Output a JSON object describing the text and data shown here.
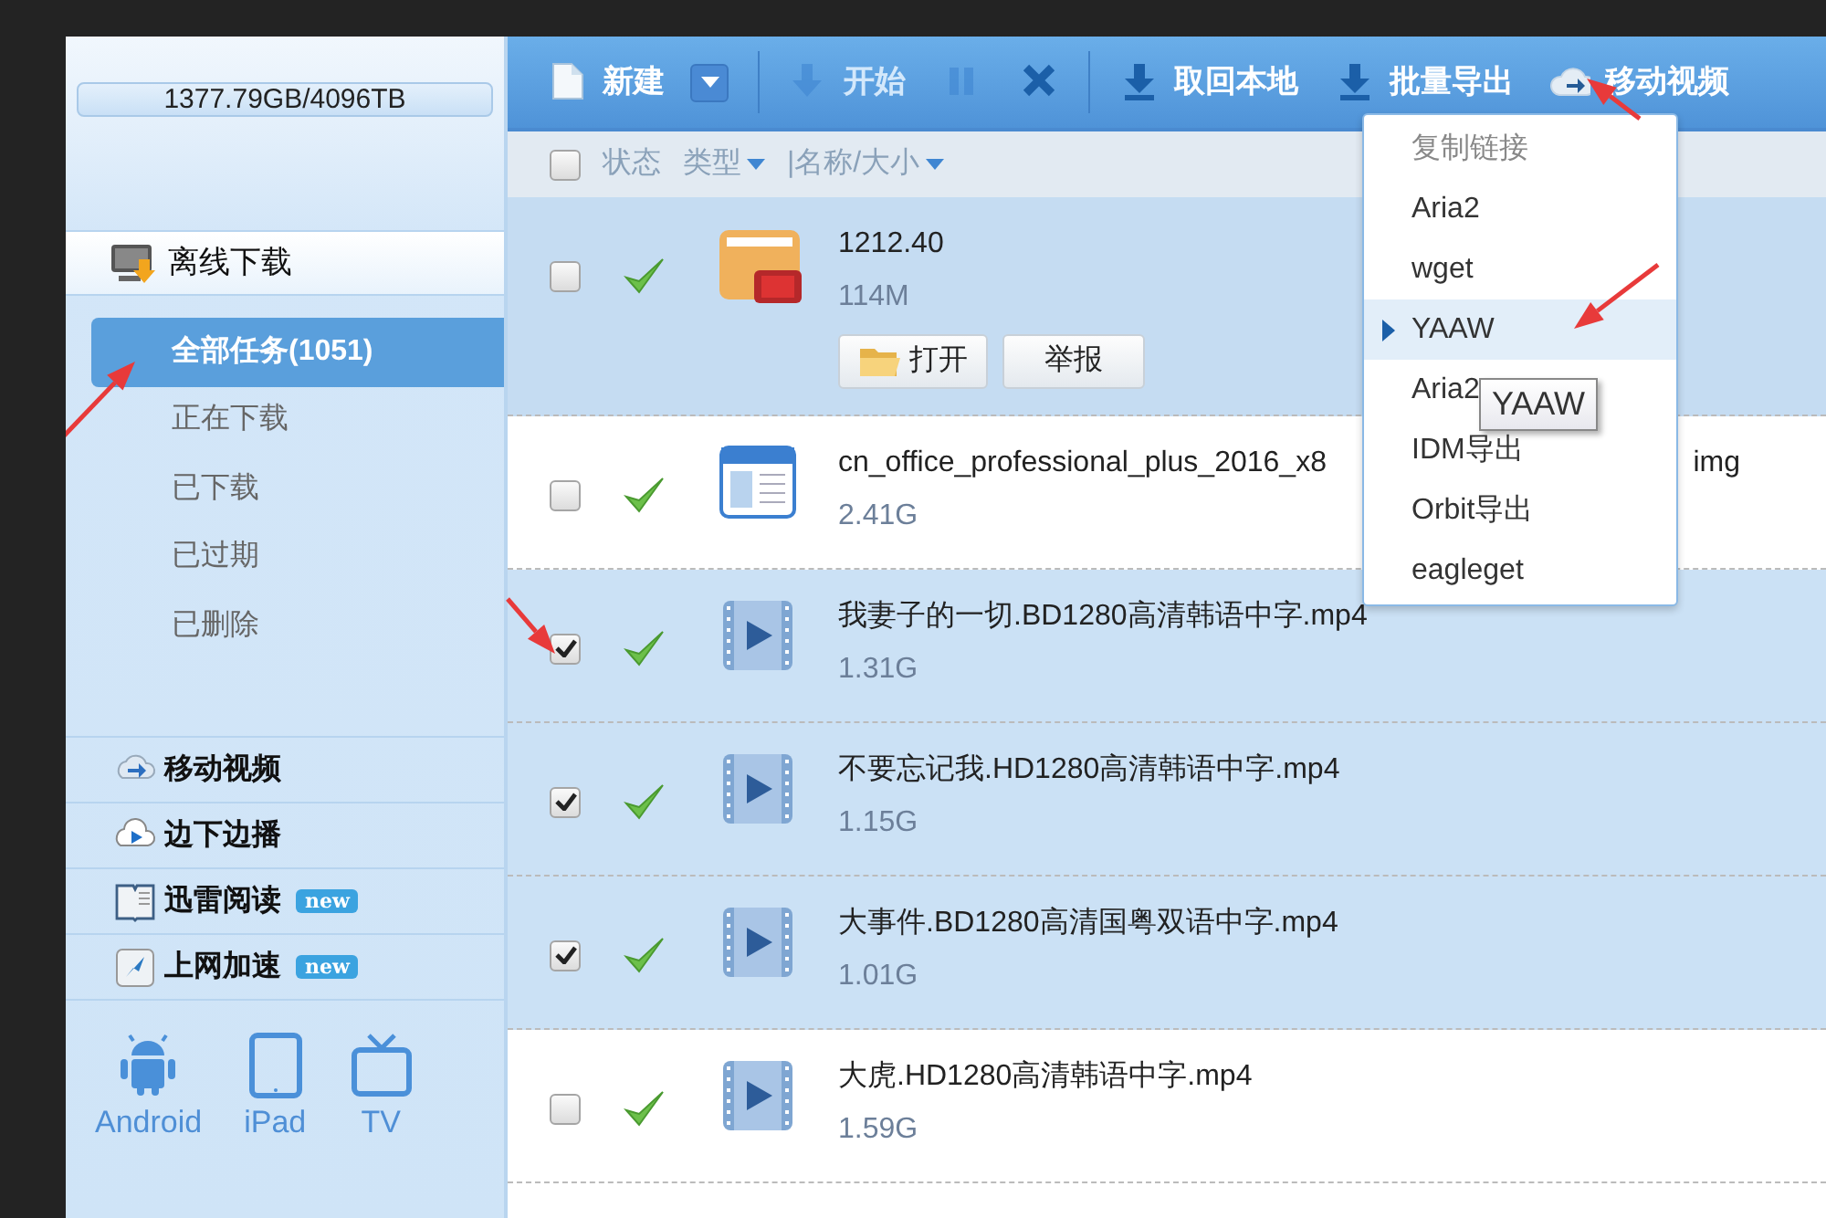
{
  "sidebar": {
    "storage": "1377.79GB/4096TB",
    "section": {
      "label": "离线下载",
      "items": [
        {
          "label": "全部任务(1051)",
          "selected": true
        },
        {
          "label": "正在下载",
          "selected": false
        },
        {
          "label": "已下载",
          "selected": false
        },
        {
          "label": "已过期",
          "selected": false
        },
        {
          "label": "已删除",
          "selected": false
        }
      ]
    },
    "links": [
      {
        "label": "移动视频",
        "kind": "cloud-arrow"
      },
      {
        "label": "边下边播",
        "kind": "cloud-play"
      },
      {
        "label": "迅雷阅读",
        "kind": "book",
        "badge": "new"
      },
      {
        "label": "上网加速",
        "kind": "bird",
        "badge": "new"
      }
    ],
    "devices": [
      {
        "label": "Android",
        "kind": "android"
      },
      {
        "label": "iPad",
        "kind": "tablet"
      },
      {
        "label": "TV",
        "kind": "tv"
      }
    ]
  },
  "toolbar": [
    {
      "label": "新建",
      "kind": "new",
      "disabled": false
    },
    {
      "label": "开始",
      "kind": "start",
      "disabled": true
    },
    {
      "kind": "pause",
      "disabled": true
    },
    {
      "kind": "delete",
      "disabled": false
    },
    {
      "label": "取回本地",
      "kind": "download",
      "disabled": false
    },
    {
      "label": "批量导出",
      "kind": "download",
      "disabled": false
    },
    {
      "label": "移动视频",
      "kind": "cloud",
      "disabled": false
    }
  ],
  "table": {
    "select_all_checked": false,
    "columns": [
      "状态",
      "类型",
      "|名称/大小"
    ],
    "rows": [
      {
        "checked": false,
        "hovered": true,
        "kind": "bt",
        "name": "1212.40",
        "size": "114M",
        "actions": [
          "打开",
          "举报"
        ]
      },
      {
        "checked": false,
        "hovered": false,
        "kind": "web",
        "name": "cn_office_professional_plus_2016_x8",
        "name_tail": "img",
        "size": "2.41G"
      },
      {
        "checked": true,
        "hovered": false,
        "kind": "video",
        "name": "我妻子的一切.BD1280高清韩语中字.mp4",
        "size": "1.31G"
      },
      {
        "checked": true,
        "hovered": false,
        "kind": "video",
        "name": "不要忘记我.HD1280高清韩语中字.mp4",
        "size": "1.15G"
      },
      {
        "checked": true,
        "hovered": false,
        "kind": "video",
        "name": "大事件.BD1280高清国粤双语中字.mp4",
        "size": "1.01G"
      },
      {
        "checked": false,
        "hovered": false,
        "kind": "video",
        "name": "大虎.HD1280高清韩语中字.mp4",
        "size": "1.59G"
      }
    ]
  },
  "export_menu": {
    "items": [
      {
        "label": "复制链接",
        "disabled": true,
        "selected": false
      },
      {
        "label": "Aria2",
        "disabled": false,
        "selected": false
      },
      {
        "label": "wget",
        "disabled": false,
        "selected": false
      },
      {
        "label": "YAAW",
        "disabled": false,
        "selected": true
      },
      {
        "label": "Aria2",
        "disabled": false,
        "selected": false
      },
      {
        "label": "IDM导出",
        "disabled": false,
        "selected": false
      },
      {
        "label": "Orbit导出",
        "disabled": false,
        "selected": false
      },
      {
        "label": "eagleget",
        "disabled": false,
        "selected": false
      }
    ],
    "tooltip": "YAAW"
  }
}
